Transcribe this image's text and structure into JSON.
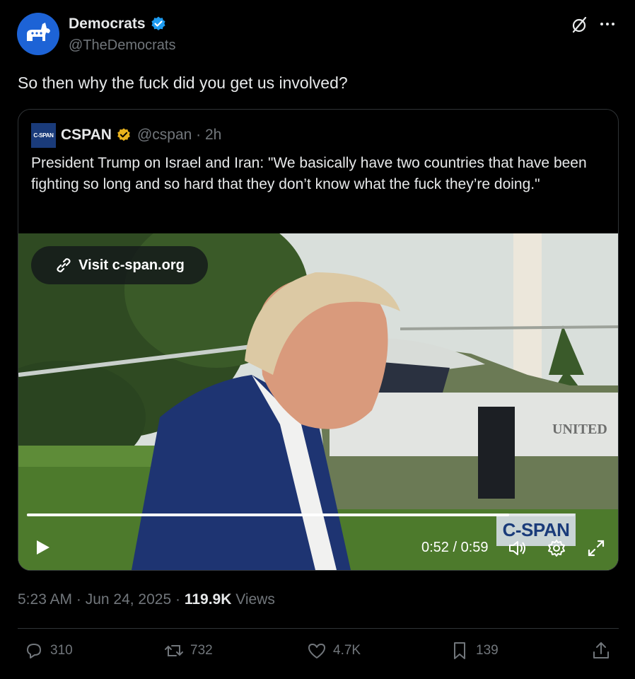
{
  "author": {
    "name": "Democrats",
    "handle": "@TheDemocrats",
    "avatar_icon": "donkey-icon",
    "verified_color": "#1d9bf0"
  },
  "tweet_text": "So then why the fuck did you get us involved?",
  "quote": {
    "logo_text": "C-SPAN",
    "name": "CSPAN",
    "handle_time": "@cspan · 2h",
    "text": "President Trump on Israel and Iran: \"We basically have two countries that have been fighting so long and so hard that they don’t know what the fuck they’re doing.\"",
    "video": {
      "visit_label": "Visit c-span.org",
      "time": "0:52 / 0:59",
      "progress": 0.88,
      "watermark": "C-SPAN",
      "scene_text": "UNITED"
    }
  },
  "meta": {
    "timestamp": "5:23 AM · Jun 24, 2025 · ",
    "views_count": "119.9K",
    "views_label": " Views"
  },
  "actions": {
    "replies": "310",
    "reposts": "732",
    "likes": "4.7K",
    "bookmarks": "139"
  },
  "colors": {
    "background": "#000000",
    "text_primary": "#e7e9ea",
    "text_secondary": "#71767b",
    "gold_badge": "#e8b21d",
    "cspan_blue": "#1a3b7a"
  }
}
